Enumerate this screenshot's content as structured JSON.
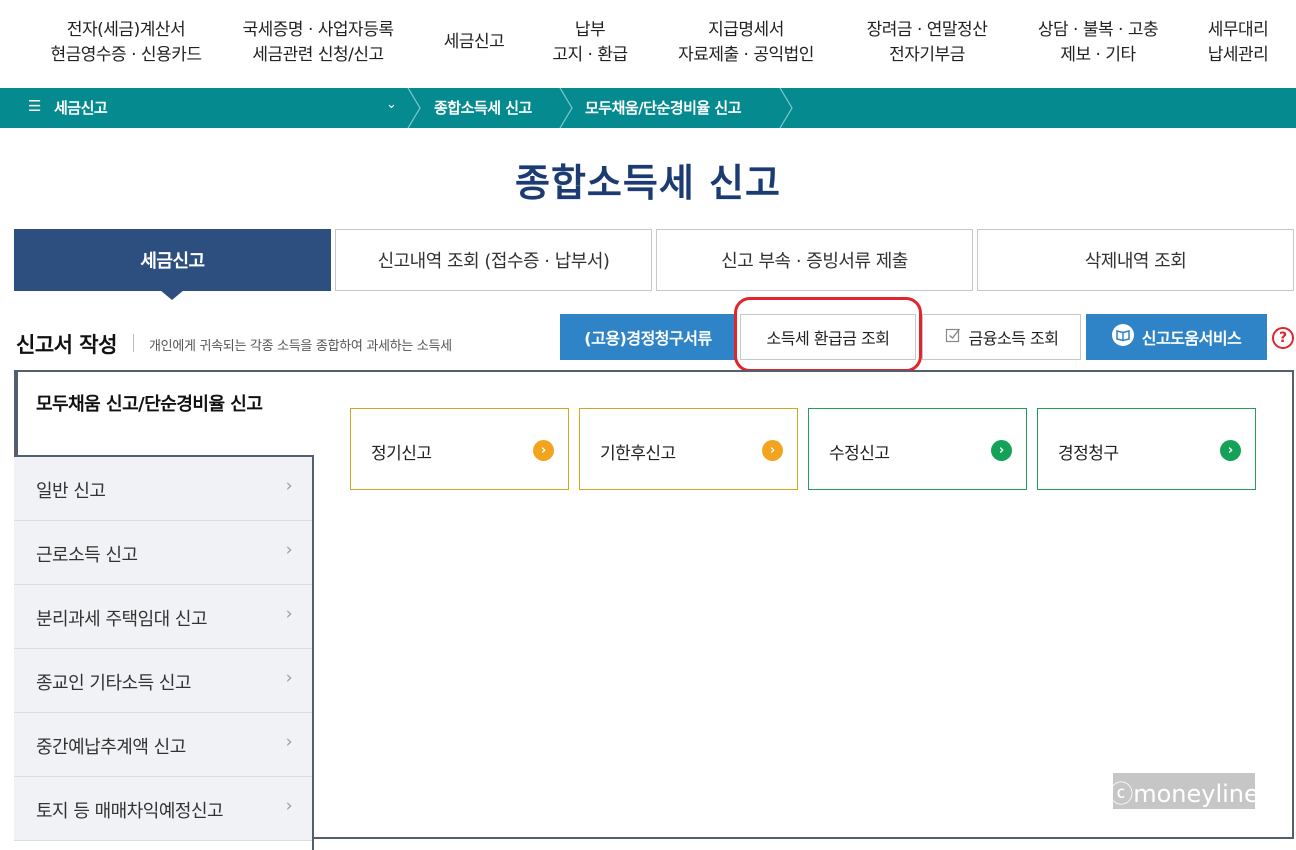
{
  "topnav": {
    "items": [
      {
        "line1": "전자(세금)계산서",
        "line2": "현금영수증 · 신용카드"
      },
      {
        "line1": "국세증명 · 사업자등록",
        "line2": "세금관련 신청/신고"
      },
      {
        "line1": "세금신고",
        "line2": ""
      },
      {
        "line1": "납부",
        "line2": "고지 · 환급"
      },
      {
        "line1": "지급명세서",
        "line2": "자료제출 · 공익법인"
      },
      {
        "line1": "장려금 · 연말정산",
        "line2": "전자기부금"
      },
      {
        "line1": "상담 · 불복 · 고충",
        "line2": "제보 · 기타"
      },
      {
        "line1": "세무대리",
        "line2": "납세관리"
      }
    ]
  },
  "breadcrumb": {
    "menu_icon": "☰",
    "home": "세금신고",
    "items": [
      "종합소득세 신고",
      "모두채움/단순경비율 신고"
    ]
  },
  "page_title": "종합소득세 신고",
  "tabs": [
    {
      "label": "세금신고",
      "active": true
    },
    {
      "label": "신고내역 조회 (접수증 · 납부서)",
      "active": false
    },
    {
      "label": "신고 부속 · 증빙서류 제출",
      "active": false
    },
    {
      "label": "삭제내역 조회",
      "active": false
    }
  ],
  "section": {
    "title": "신고서 작성",
    "description": "개인에게 귀속되는 각종 소득을 종합하여 과세하는 소득세"
  },
  "actions": {
    "claim_docs": "(고용)경정청구서류",
    "refund_lookup": "소득세 환급금 조회",
    "financial_income": "금융소득 조회",
    "help_service": "신고도움서비스",
    "help_mark": "?"
  },
  "sidebar": {
    "active": "모두채움 신고/단순경비율 신고",
    "items": [
      "일반 신고",
      "근로소득 신고",
      "분리과세 주택임대 신고",
      "종교인 기타소득 신고",
      "중간예납추계액 신고",
      "토지 등 매매차익예정신고"
    ]
  },
  "cards": [
    {
      "label": "정기신고",
      "color": "#f3a41f"
    },
    {
      "label": "기한후신고",
      "color": "#f3a41f"
    },
    {
      "label": "수정신고",
      "color": "#13a257"
    },
    {
      "label": "경정청구",
      "color": "#13a257"
    }
  ],
  "watermark": "ⓒmoneyline",
  "colors": {
    "teal_bar": "#048a8f",
    "navy_title": "#1c3b72",
    "active_tab": "#2c4f7f",
    "blue_button": "#2f84c7",
    "highlight_red": "#e2242c"
  }
}
